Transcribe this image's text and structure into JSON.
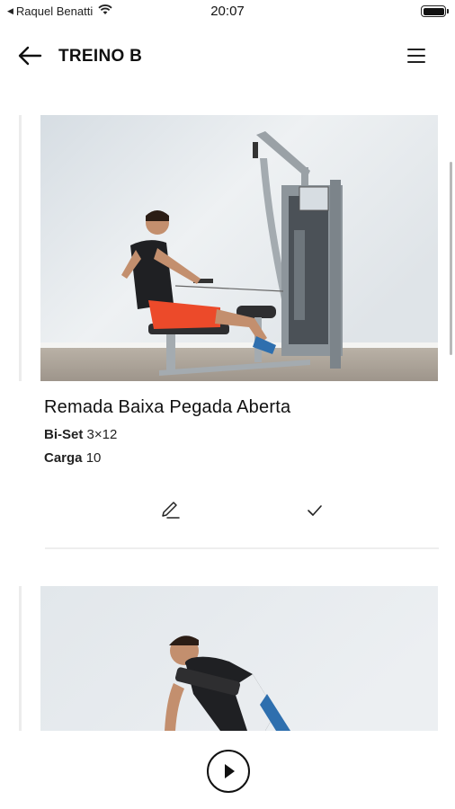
{
  "status_bar": {
    "carrier": "Raquel Benatti",
    "time": "20:07",
    "battery_level": 1.0
  },
  "header": {
    "title": "TREINO B",
    "back_icon": "arrow-left-icon",
    "menu_icon": "hamburger-menu-icon"
  },
  "exercises": [
    {
      "name": "Remada Baixa Pegada Aberta",
      "set_label": "Bi-Set",
      "set_value": "3×12",
      "load_label": "Carga",
      "load_value": "10",
      "edit_icon": "pencil-icon",
      "done_icon": "check-icon"
    },
    {
      "name": "",
      "set_label": "",
      "set_value": "",
      "load_label": "",
      "load_value": ""
    }
  ],
  "bottom": {
    "play_icon": "play-icon"
  },
  "colors": {
    "background": "#ffffff",
    "text": "#111111",
    "divider": "#eeeeee",
    "accent_line": "#ececec"
  }
}
